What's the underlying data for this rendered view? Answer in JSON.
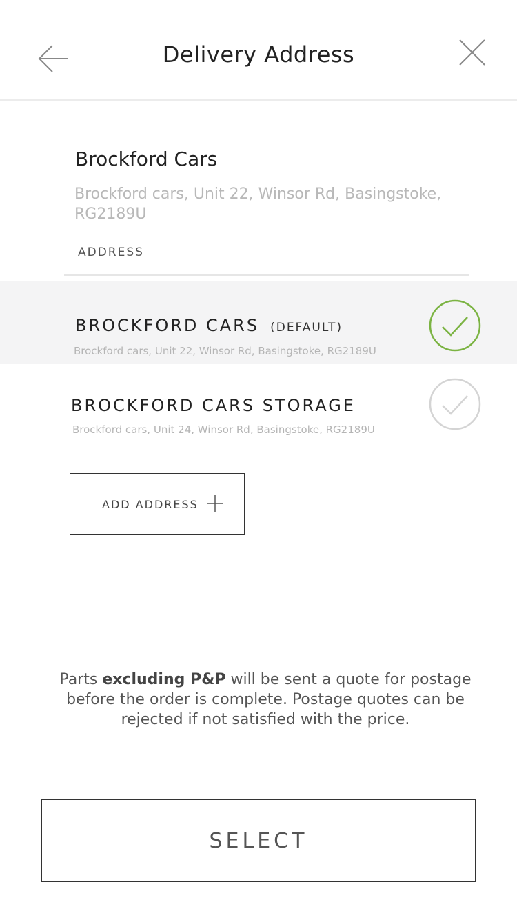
{
  "header": {
    "title": "Delivery Address",
    "back_icon": "arrow-left-icon",
    "close_icon": "close-icon"
  },
  "selected_address": {
    "name": "Brockford Cars",
    "address_line": "Brockford cars, Unit 22, Winsor Rd, Basingstoke, RG2189U",
    "field_label": "ADDRESS"
  },
  "addresses": [
    {
      "name": "BROCKFORD CARS",
      "tag": "(DEFAULT)",
      "address": "Brockford cars, Unit 22, Winsor Rd, Basingstoke, RG2189U",
      "selected": true
    },
    {
      "name": "BROCKFORD CARS STORAGE",
      "tag": "",
      "address": "Brockford cars, Unit 24, Winsor Rd, Basingstoke, RG2189U",
      "selected": false
    }
  ],
  "add_address": {
    "label": "ADD ADDRESS",
    "icon": "plus-icon"
  },
  "notice": {
    "prefix": "Parts ",
    "bold": "excluding P&P",
    "suffix": " will be sent a quote for postage before the order is complete. Postage quotes can be rejected if not satisfied with the price."
  },
  "select_button": {
    "label": "SELECT"
  },
  "colors": {
    "accent_green": "#7bb342",
    "inactive_grey": "#d4d4d4",
    "selected_row_bg": "#f4f4f5"
  }
}
